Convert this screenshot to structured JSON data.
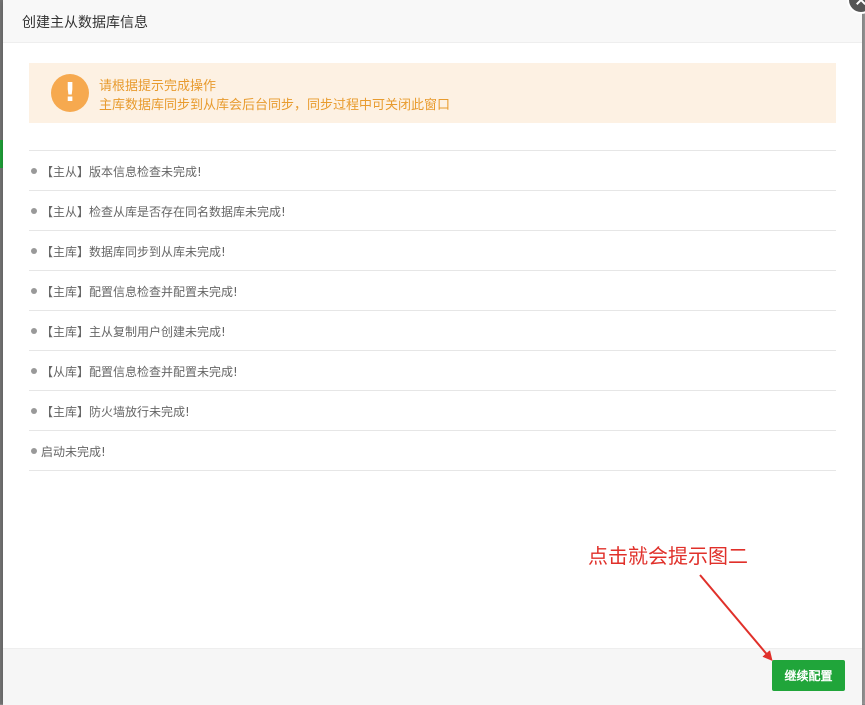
{
  "dialog": {
    "title": "创建主从数据库信息"
  },
  "notice": {
    "icon": "exclamation-icon",
    "title": "请根据提示完成操作",
    "description": "主库数据库同步到从库会后台同步，同步过程中可关闭此窗口"
  },
  "steps": [
    "【主从】版本信息检查未完成!",
    "【主从】检查从库是否存在同名数据库未完成!",
    "【主库】数据库同步到从库未完成!",
    "【主库】配置信息检查并配置未完成!",
    "【主库】主从复制用户创建未完成!",
    "【从库】配置信息检查并配置未完成!",
    "【主库】防火墙放行未完成!",
    "启动未完成!"
  ],
  "annotation": {
    "text": "点击就会提示图二",
    "color": "#e0302a"
  },
  "footer": {
    "continue_label": "继续配置"
  },
  "colors": {
    "accent": "#20a53a",
    "warning": "#e89b2e",
    "warning_bg": "#fdf1e3"
  }
}
